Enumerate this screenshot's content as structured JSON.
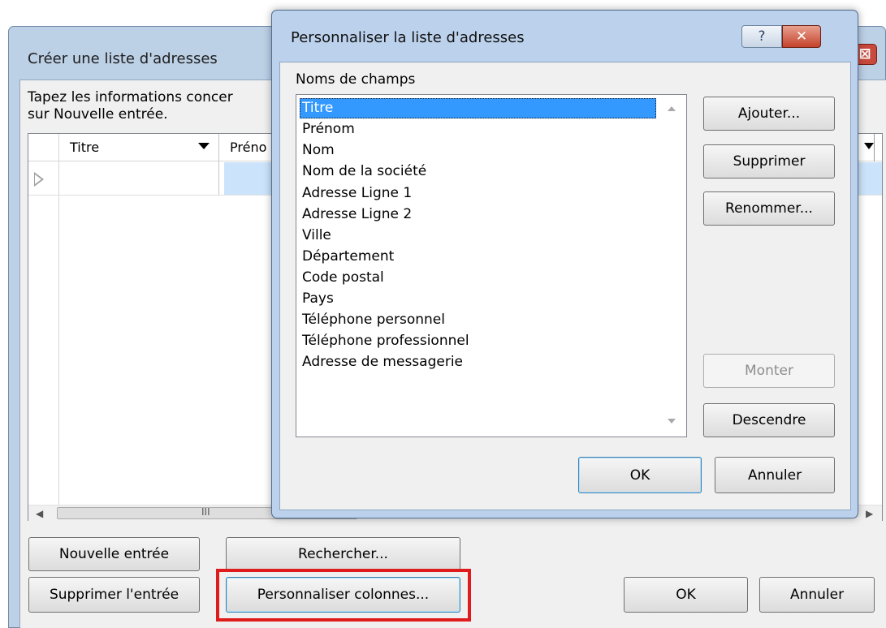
{
  "background_window": {
    "title": "Créer une liste d'adresses",
    "close_glyph": "⊠",
    "instructions_line1": "Tapez les informations concer",
    "instructions_line2": "sur Nouvelle entrée.",
    "columns": [
      "Titre",
      "Préno"
    ],
    "scroll_grip": "III",
    "buttons": {
      "new_entry": "Nouvelle entrée",
      "search": "Rechercher...",
      "delete_entry": "Supprimer l'entrée",
      "customize_columns": "Personnaliser colonnes...",
      "ok": "OK",
      "cancel": "Annuler"
    },
    "highlight_color": "#e01b1b"
  },
  "dialog": {
    "title": "Personnaliser la liste d'adresses",
    "help_glyph": "?",
    "close_glyph": "✕",
    "fields_label": "Noms de champs",
    "fields": [
      "Titre",
      "Prénom",
      "Nom",
      "Nom de la société",
      "Adresse Ligne 1",
      "Adresse Ligne 2",
      "Ville",
      "Département",
      "Code postal",
      "Pays",
      "Téléphone personnel",
      "Téléphone professionnel",
      "Adresse de messagerie"
    ],
    "selected_field": "Titre",
    "buttons": {
      "add": "Ajouter...",
      "remove": "Supprimer",
      "rename": "Renommer...",
      "up": "Monter",
      "down": "Descendre",
      "ok": "OK",
      "cancel": "Annuler"
    }
  },
  "colors": {
    "selection": "#3399ff",
    "frame": "#bcd2ec"
  }
}
